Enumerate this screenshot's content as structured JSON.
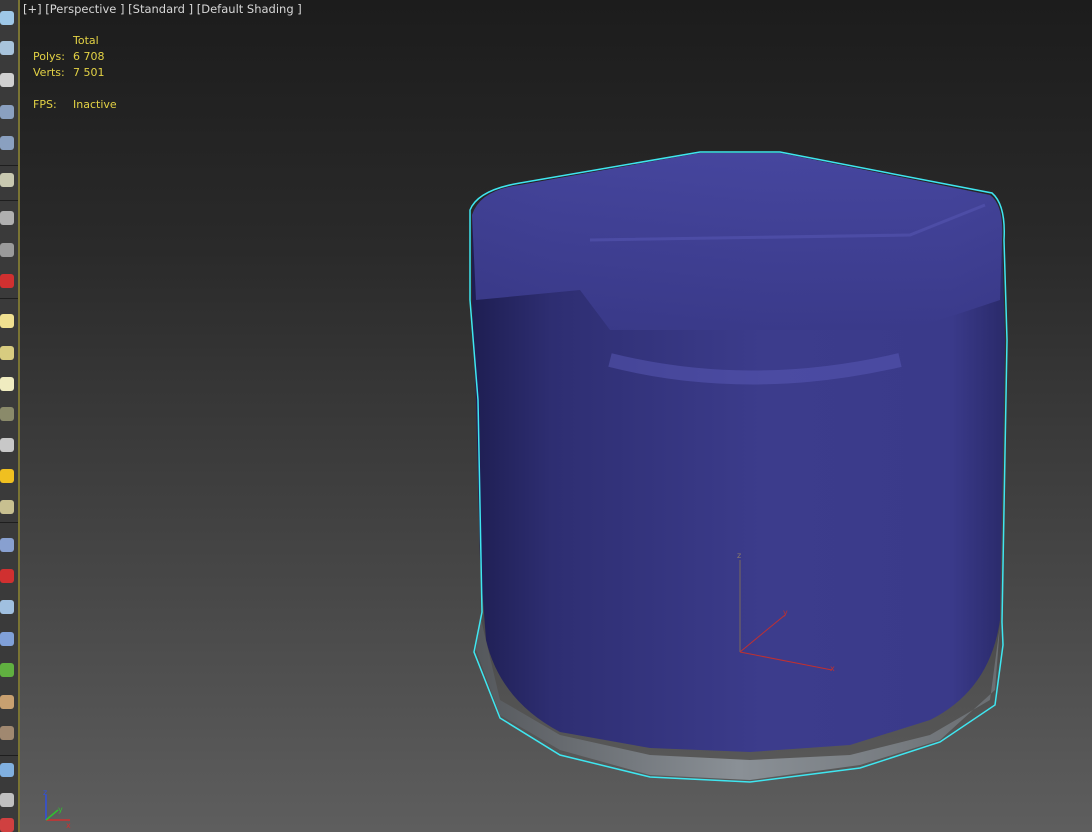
{
  "viewport": {
    "label_parts": [
      "[+]",
      "[Perspective ]",
      "[Standard ]",
      "[Default Shading ]"
    ],
    "stats": {
      "header": "Total",
      "polys_label": "Polys:",
      "polys_value": "6 708",
      "verts_label": "Verts:",
      "verts_value": "7 501",
      "fps_label": "FPS:",
      "fps_value": "Inactive"
    },
    "gizmo_axes": [
      "x",
      "y",
      "z"
    ],
    "selection_color": "#3fe6f0",
    "object_color": "#3b3b8e"
  },
  "toolbar": {
    "icons": [
      "teapot-icon",
      "cloud-icon",
      "render-frame-icon",
      "table-icon",
      "layout-icon",
      "keyboard-icon",
      "camera-icon",
      "sphere-half-icon",
      "red-bulb-icon",
      "box-icon",
      "dome-icon",
      "disc-icon",
      "turtle-icon",
      "cone-icon",
      "sun-icon",
      "ellipse-icon",
      "particles-icon",
      "pin-icon",
      "wire-pyramid-icon",
      "gear-icon",
      "grass-icon",
      "shell-icon",
      "spiral-icon",
      "sphere-icon",
      "cursor-icon",
      "frame-icon"
    ]
  }
}
